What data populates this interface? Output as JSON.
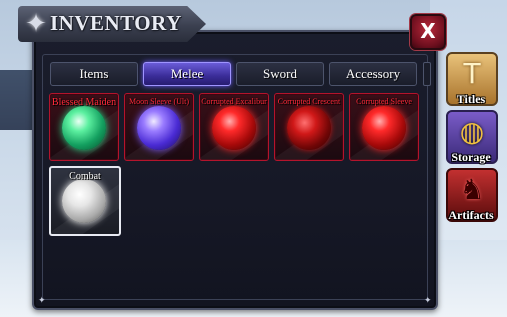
{
  "window": {
    "title": "INVENTORY",
    "close_label": "X"
  },
  "tabs": [
    {
      "label": "Items",
      "active": false
    },
    {
      "label": "Melee",
      "active": true
    },
    {
      "label": "Sword",
      "active": false
    },
    {
      "label": "Accessory",
      "active": false
    }
  ],
  "slots": [
    {
      "name": "Blessed Maiden",
      "orb": "green"
    },
    {
      "name": "Moon Sleeve (Ult)",
      "orb": "purple"
    },
    {
      "name": "Corrupted Excalibur",
      "orb": "red"
    },
    {
      "name": "Corrupted Crescent",
      "orb": "darkred"
    },
    {
      "name": "Corrupted Sleeve",
      "orb": "red"
    },
    {
      "name": "Combat",
      "orb": "white"
    }
  ],
  "side_menu": [
    {
      "label": "Titles",
      "icon": "titles-icon"
    },
    {
      "label": "Storage",
      "icon": "storage-icon"
    },
    {
      "label": "Artifacts",
      "icon": "artifacts-icon"
    }
  ],
  "colors": {
    "accent_active_tab": "#6a5cd8",
    "slot_border_red": "#b4142c",
    "slot_name_red": "#ff2a3a",
    "close_button_red": "#b8283a"
  }
}
